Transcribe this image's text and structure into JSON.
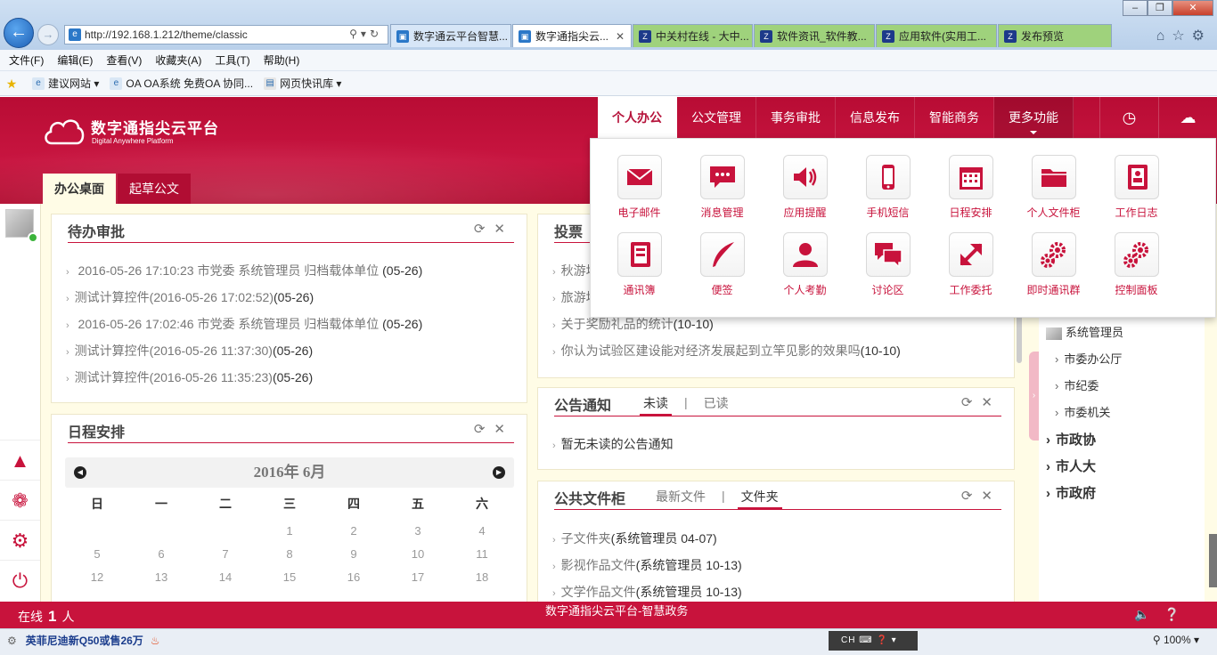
{
  "browser": {
    "url": "http://192.168.1.212/theme/classic",
    "tabs": [
      {
        "label": "数字通云平台智慧...",
        "style": "blue"
      },
      {
        "label": "数字通指尖云...",
        "style": "active"
      },
      {
        "label": "中关村在线 - 大中...",
        "style": "green"
      },
      {
        "label": "软件资讯_软件教...",
        "style": "green"
      },
      {
        "label": "应用软件(实用工...",
        "style": "green"
      },
      {
        "label": "发布预览",
        "style": "green"
      }
    ],
    "menu": [
      "文件(F)",
      "编辑(E)",
      "查看(V)",
      "收藏夹(A)",
      "工具(T)",
      "帮助(H)"
    ],
    "favorites": [
      "建议网站 ▾",
      "OA OA系统 免费OA 协同...",
      "网页快讯库 ▾"
    ],
    "status_news": "英菲尼迪新Q50或售26万",
    "ime": "CH",
    "zoom": "100%"
  },
  "app": {
    "title": "数字通指尖云平台",
    "subtitle": "Digital Anywhere Platform",
    "nav": [
      {
        "label": "个人办公",
        "active": true
      },
      {
        "label": "公文管理"
      },
      {
        "label": "事务审批"
      },
      {
        "label": "信息发布"
      },
      {
        "label": "智能商务"
      },
      {
        "label": "更多功能",
        "more": true
      }
    ],
    "subtabs": [
      "办公桌面",
      "起草公文"
    ],
    "accent": "#c8133c"
  },
  "dropdown": [
    {
      "label": "电子邮件",
      "icon": "mail-icon"
    },
    {
      "label": "消息管理",
      "icon": "chat-icon"
    },
    {
      "label": "应用提醒",
      "icon": "speaker-icon"
    },
    {
      "label": "手机短信",
      "icon": "phone-icon"
    },
    {
      "label": "日程安排",
      "icon": "calendar-icon"
    },
    {
      "label": "个人文件柜",
      "icon": "folder-icon"
    },
    {
      "label": "工作日志",
      "icon": "notebook-icon"
    },
    {
      "label": "通讯簿",
      "icon": "contacts-icon"
    },
    {
      "label": "便签",
      "icon": "quill-icon"
    },
    {
      "label": "个人考勤",
      "icon": "person-icon"
    },
    {
      "label": "讨论区",
      "icon": "discussion-icon"
    },
    {
      "label": "工作委托",
      "icon": "expand-arrow-icon"
    },
    {
      "label": "即时通讯群",
      "icon": "gears-icon"
    },
    {
      "label": "控制面板",
      "icon": "gears-icon"
    }
  ],
  "pending": {
    "title": "待办审批",
    "items": [
      {
        "grey": " 2016-05-26 17:10:23 市党委 系统管理员 归档载体单位",
        "tail": " (05-26)"
      },
      {
        "grey": "测试计算控件(2016-05-26 17:02:52)",
        "tail": "(05-26)"
      },
      {
        "grey": " 2016-05-26 17:02:46 市党委 系统管理员 归档载体单位",
        "tail": " (05-26)"
      },
      {
        "grey": "测试计算控件(2016-05-26 11:37:30)",
        "tail": "(05-26)"
      },
      {
        "grey": "测试计算控件(2016-05-26 11:35:23)",
        "tail": "(05-26)"
      }
    ]
  },
  "schedule": {
    "title": "日程安排",
    "month": "2016年 6月",
    "dow": [
      "日",
      "一",
      "二",
      "三",
      "四",
      "五",
      "六"
    ],
    "days": [
      "",
      "",
      "",
      "1",
      "2",
      "3",
      "4",
      "5",
      "6",
      "7",
      "8",
      "9",
      "10",
      "11",
      "12",
      "13",
      "14",
      "15",
      "16",
      "17",
      "18"
    ]
  },
  "vote": {
    "title": "投票",
    "items": [
      {
        "grey": "秋游地",
        "tail": ""
      },
      {
        "grey": "旅游地",
        "tail": ""
      },
      {
        "grey": "关于奖励礼品的统计",
        "tail": "(10-10)"
      },
      {
        "grey": "你认为试验区建设能对经济发展起到立竿见影的效果吗",
        "tail": "(10-10)"
      }
    ]
  },
  "notice": {
    "title": "公告通知",
    "tabs": [
      "未读",
      "已读"
    ],
    "sep": "|",
    "items": [
      "暂无未读的公告通知"
    ]
  },
  "files": {
    "title": "公共文件柜",
    "tabs": [
      "最新文件",
      "文件夹"
    ],
    "sep": "|",
    "items": [
      {
        "grey": "子文件夹",
        "tail": "(系统管理员 04-07)"
      },
      {
        "grey": "影视作品文件",
        "tail": "(系统管理员 10-13)"
      },
      {
        "grey": "文学作品文件",
        "tail": "(系统管理员 10-13)"
      }
    ]
  },
  "org_tree": {
    "user": "系统管理员",
    "children": [
      "市委办公厅",
      "市纪委",
      "市委机关"
    ],
    "groups": [
      "市政协",
      "市人大",
      "市政府"
    ]
  },
  "footer": {
    "online_label": "在线",
    "online_count": "1",
    "online_unit": "人",
    "center": "数字通指尖云平台-智慧政务"
  }
}
